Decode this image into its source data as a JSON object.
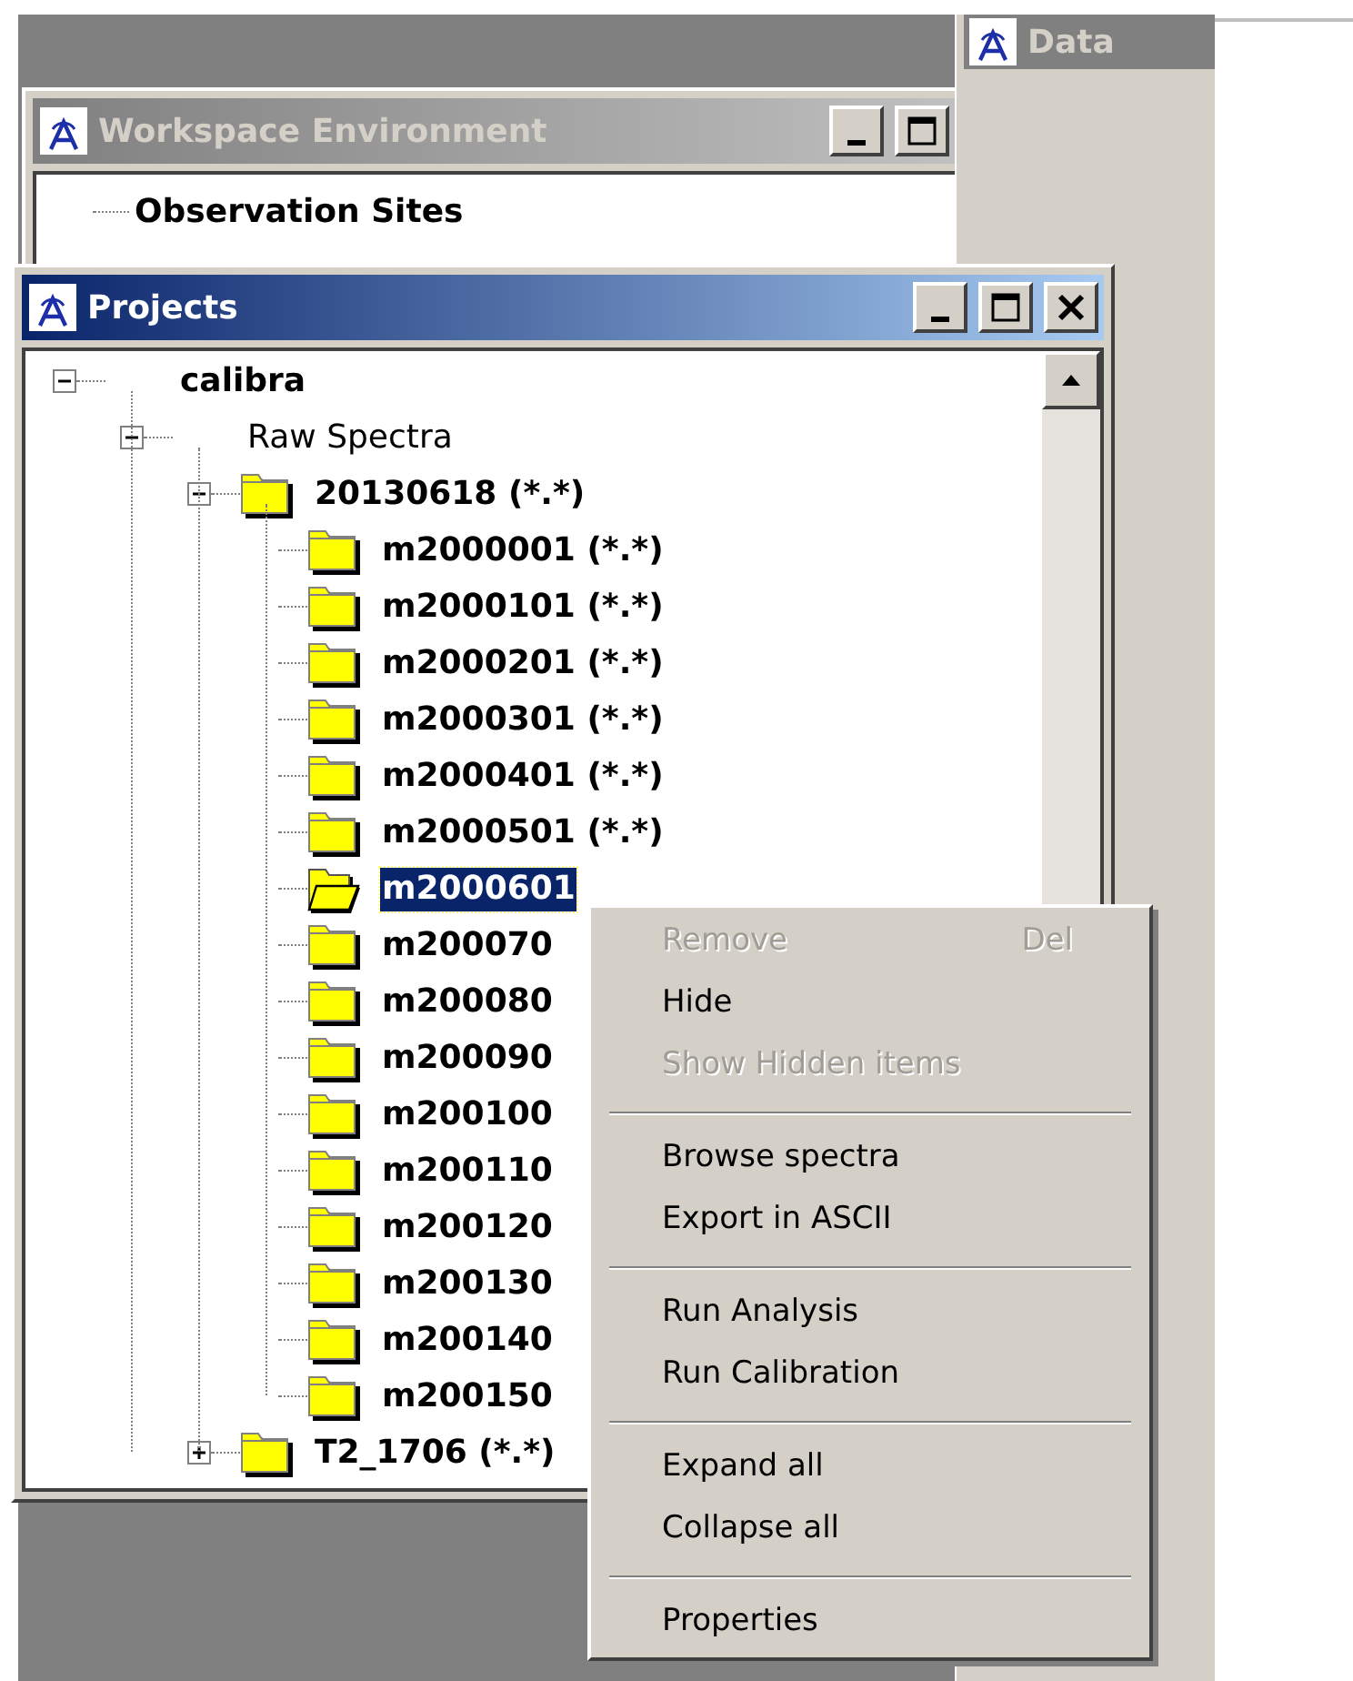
{
  "data_window": {
    "title": "Data",
    "active": false
  },
  "workspace_window": {
    "title": "Workspace Environment",
    "active": false,
    "tree": [
      {
        "label": "Observation Sites"
      }
    ]
  },
  "projects_window": {
    "title": "Projects",
    "active": true,
    "tree": [
      {
        "label": "calibra",
        "kind": "project",
        "expanded": true,
        "selected": false,
        "children": [
          {
            "label": "Raw Spectra",
            "kind": "category",
            "expanded": true,
            "selected": false,
            "children": [
              {
                "label": "20130618 (*.*)",
                "kind": "folder",
                "expanded": true,
                "selected": false,
                "children": [
                  {
                    "label": "m2000001 (*.*)",
                    "kind": "folder",
                    "selected": false
                  },
                  {
                    "label": "m2000101 (*.*)",
                    "kind": "folder",
                    "selected": false
                  },
                  {
                    "label": "m2000201 (*.*)",
                    "kind": "folder",
                    "selected": false
                  },
                  {
                    "label": "m2000301 (*.*)",
                    "kind": "folder",
                    "selected": false
                  },
                  {
                    "label": "m2000401 (*.*)",
                    "kind": "folder",
                    "selected": false
                  },
                  {
                    "label": "m2000501 (*.*)",
                    "kind": "folder",
                    "selected": false
                  },
                  {
                    "label": "m2000601",
                    "kind": "folder",
                    "selected": true
                  },
                  {
                    "label": "m200070",
                    "kind": "folder",
                    "selected": false
                  },
                  {
                    "label": "m200080",
                    "kind": "folder",
                    "selected": false
                  },
                  {
                    "label": "m200090",
                    "kind": "folder",
                    "selected": false
                  },
                  {
                    "label": "m200100",
                    "kind": "folder",
                    "selected": false
                  },
                  {
                    "label": "m200110",
                    "kind": "folder",
                    "selected": false
                  },
                  {
                    "label": "m200120",
                    "kind": "folder",
                    "selected": false
                  },
                  {
                    "label": "m200130",
                    "kind": "folder",
                    "selected": false
                  },
                  {
                    "label": "m200140",
                    "kind": "folder",
                    "selected": false
                  },
                  {
                    "label": "m200150",
                    "kind": "folder",
                    "selected": false
                  }
                ]
              },
              {
                "label": "T2_1706 (*.*)",
                "kind": "folder",
                "expanded": false,
                "selected": false
              }
            ]
          }
        ]
      }
    ]
  },
  "context_menu": [
    {
      "kind": "item",
      "label": "Remove",
      "shortcut": "Del",
      "disabled": true
    },
    {
      "kind": "item",
      "label": "Hide",
      "disabled": false
    },
    {
      "kind": "item",
      "label": "Show Hidden items",
      "disabled": true
    },
    {
      "kind": "separator"
    },
    {
      "kind": "item",
      "label": "Browse spectra",
      "disabled": false
    },
    {
      "kind": "item",
      "label": "Export in ASCII",
      "disabled": false
    },
    {
      "kind": "separator"
    },
    {
      "kind": "item",
      "label": "Run Analysis",
      "disabled": false
    },
    {
      "kind": "item",
      "label": "Run Calibration",
      "disabled": false
    },
    {
      "kind": "separator"
    },
    {
      "kind": "item",
      "label": "Expand all",
      "disabled": false
    },
    {
      "kind": "item",
      "label": "Collapse all",
      "disabled": false
    },
    {
      "kind": "separator"
    },
    {
      "kind": "item",
      "label": "Properties",
      "disabled": false
    }
  ]
}
